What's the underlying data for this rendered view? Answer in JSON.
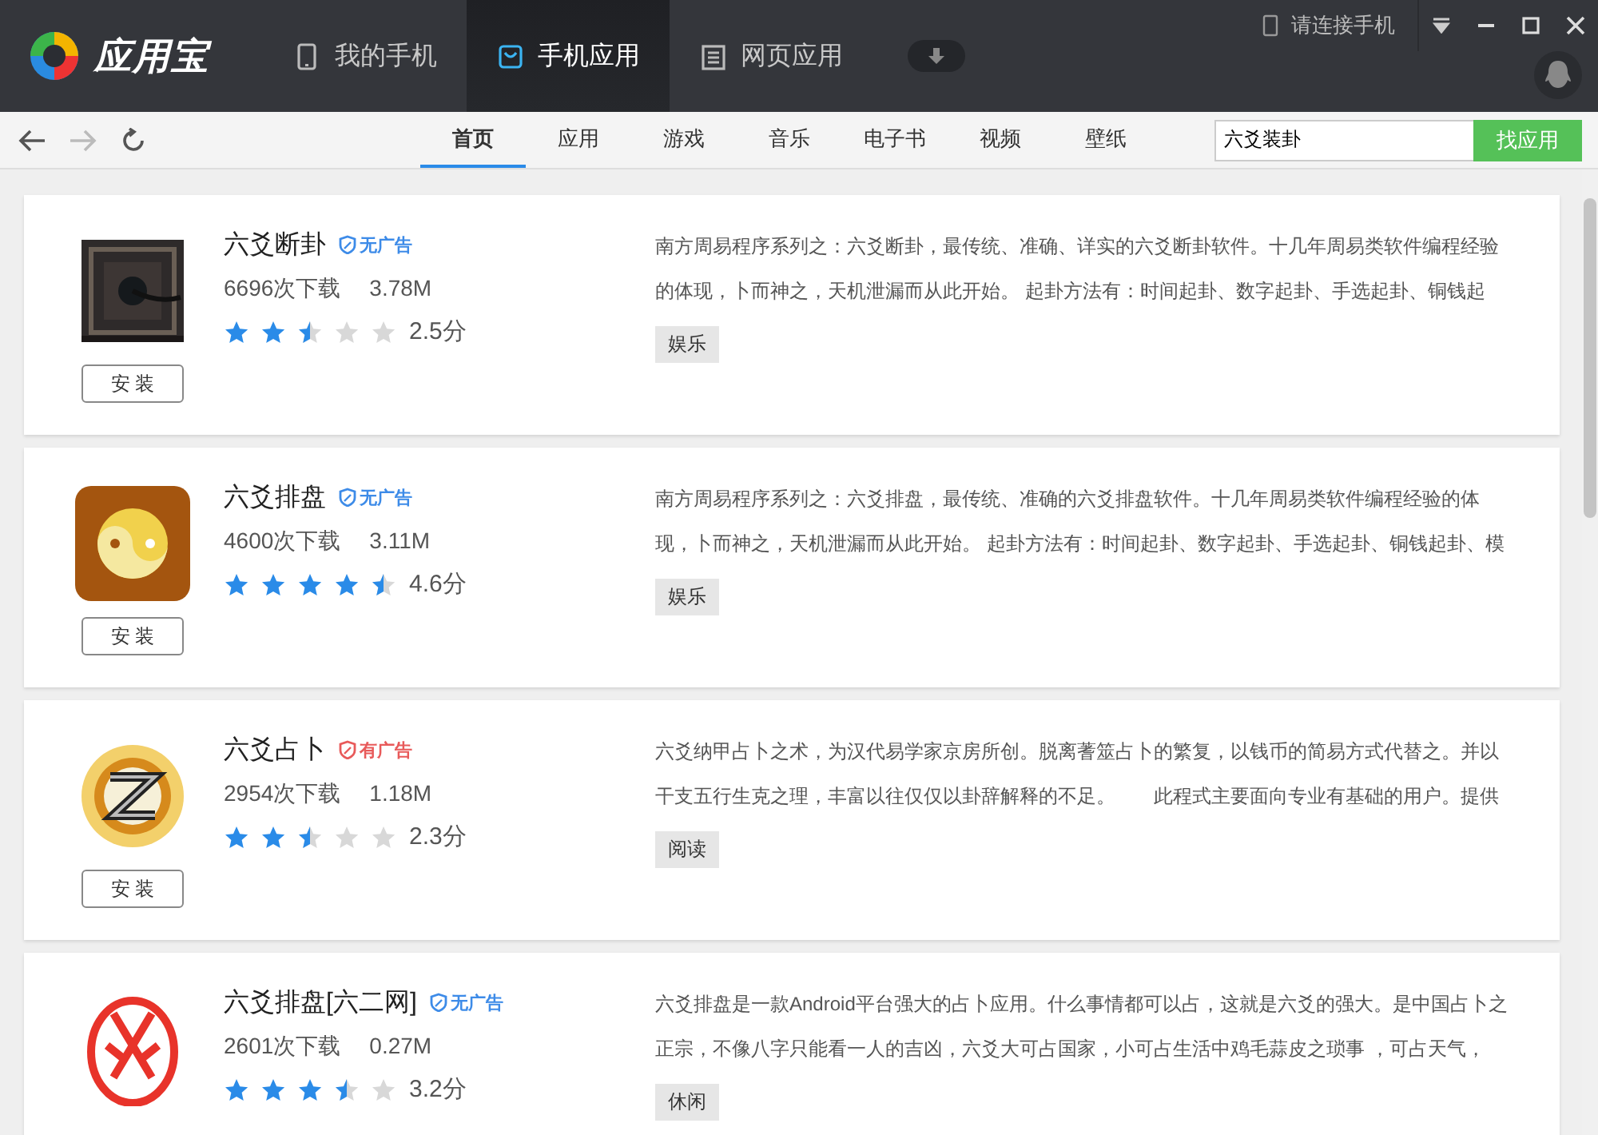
{
  "app": {
    "name": "应用宝"
  },
  "main_tabs": [
    {
      "label": "我的手机",
      "kind": "phone",
      "selected": false
    },
    {
      "label": "手机应用",
      "kind": "bag",
      "selected": true
    },
    {
      "label": "网页应用",
      "kind": "page",
      "selected": false
    }
  ],
  "connect": {
    "label": "请连接手机"
  },
  "nav": {
    "back_disabled": false,
    "forward_disabled": true
  },
  "categories": [
    {
      "label": "首页",
      "selected": true
    },
    {
      "label": "应用",
      "selected": false
    },
    {
      "label": "游戏",
      "selected": false
    },
    {
      "label": "音乐",
      "selected": false
    },
    {
      "label": "电子书",
      "selected": false
    },
    {
      "label": "视频",
      "selected": false
    },
    {
      "label": "壁纸",
      "selected": false
    }
  ],
  "search": {
    "value": "六爻装卦",
    "button": "找应用"
  },
  "apps": [
    {
      "name": "六爻断卦",
      "ads": {
        "kind": "no_ads",
        "label": "无广告"
      },
      "downloads": "6696次下载",
      "size": "3.78M",
      "stars": 2.5,
      "score": "2.5分",
      "description": "南方周易程序系列之：六爻断卦，最传统、准确、详实的六爻断卦软件。十几年周易类软件编程经验的体现，卜而神之，天机泄漏而从此开始。 起卦方法有：时间起卦、数字起卦、手选起卦、铜钱起",
      "tag": "娱乐",
      "install": "安 装",
      "kind": "board"
    },
    {
      "name": "六爻排盘",
      "ads": {
        "kind": "no_ads",
        "label": "无广告"
      },
      "downloads": "4600次下载",
      "size": "3.11M",
      "stars": 4.5,
      "score": "4.6分",
      "description": "南方周易程序系列之：六爻排盘，最传统、准确的六爻排盘软件。十几年周易类软件编程经验的体现，卜而神之，天机泄漏而从此开始。 起卦方法有：时间起卦、数字起卦、手选起卦、铜钱起卦、模",
      "tag": "娱乐",
      "install": "安 装",
      "kind": "yinyang"
    },
    {
      "name": "六爻占卜",
      "ads": {
        "kind": "has_ads",
        "label": "有广告"
      },
      "downloads": "2954次下载",
      "size": "1.18M",
      "stars": 2.5,
      "score": "2.3分",
      "description": "六爻纳甲占卜之术，为汉代易学家京房所创。脱离蓍筮占卜的繁复，以钱币的简易方式代替之。并以干支五行生克之理，丰富以往仅仅以卦辞解释的不足。　　此程式主要面向专业有基础的用户。提供",
      "tag": "阅读",
      "install": "安 装",
      "kind": "sun"
    },
    {
      "name": "六爻排盘[六二网]",
      "ads": {
        "kind": "no_ads",
        "label": "无广告"
      },
      "downloads": "2601次下载",
      "size": "0.27M",
      "stars": 3.5,
      "score": "3.2分",
      "description": "六爻排盘是一款Android平台强大的占卜应用。什么事情都可以占，这就是六爻的强大。是中国占卜之正宗，不像八字只能看一人的吉凶，六爻大可占国家，小可占生活中鸡毛蒜皮之琐事 ，可占天气，",
      "tag": "休闲",
      "kind": "seal"
    }
  ]
}
